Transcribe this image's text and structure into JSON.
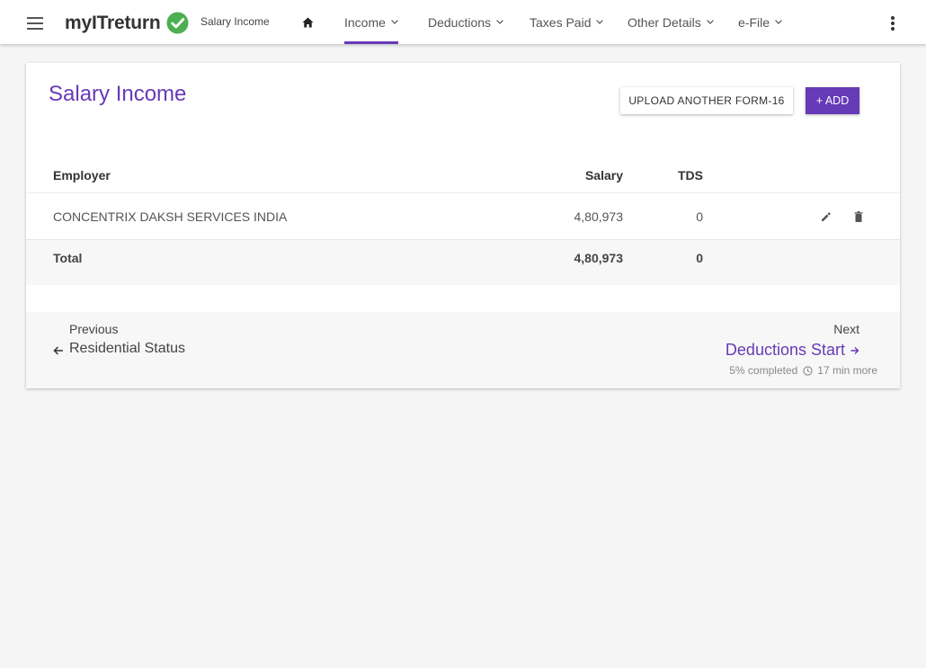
{
  "header": {
    "logo_text": "myITreturn",
    "breadcrumb": "Salary Income",
    "nav": [
      {
        "label": "Income",
        "active": true
      },
      {
        "label": "Deductions",
        "active": false
      },
      {
        "label": "Taxes Paid",
        "active": false
      },
      {
        "label": "Other Details",
        "active": false
      },
      {
        "label": "e-File",
        "active": false
      }
    ]
  },
  "card": {
    "title": "Salary Income",
    "upload_label": "UPLOAD ANOTHER FORM-16",
    "add_label": "+ ADD"
  },
  "table": {
    "columns": {
      "employer": "Employer",
      "salary": "Salary",
      "tds": "TDS"
    },
    "rows": [
      {
        "employer": "CONCENTRIX DAKSH SERVICES INDIA",
        "salary": "4,80,973",
        "tds": "0"
      }
    ],
    "total": {
      "label": "Total",
      "salary": "4,80,973",
      "tds": "0"
    }
  },
  "pager": {
    "previous_label": "Previous",
    "previous_target": "Residential Status",
    "next_label": "Next",
    "next_target": "Deductions Start",
    "progress": "5% completed",
    "time_left": "17 min more"
  },
  "colors": {
    "accent": "#673ab7",
    "logo_check": "#4caf50"
  }
}
